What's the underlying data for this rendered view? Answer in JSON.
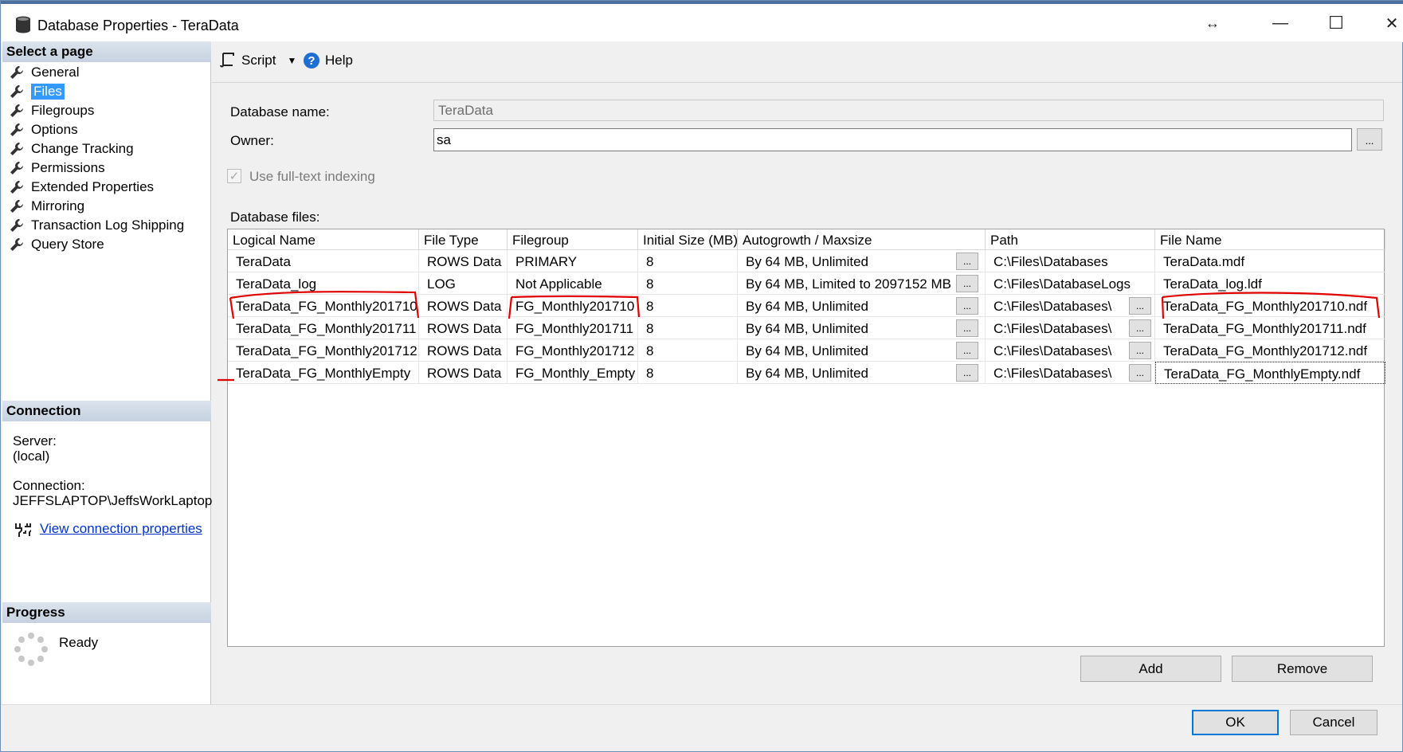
{
  "window": {
    "title": "Database Properties - TeraData",
    "controls": {
      "resize": "↔",
      "minimize": "—",
      "maximize": "☐",
      "close": "✕"
    }
  },
  "left": {
    "select_header": "Select a page",
    "pages": [
      "General",
      "Files",
      "Filegroups",
      "Options",
      "Change Tracking",
      "Permissions",
      "Extended Properties",
      "Mirroring",
      "Transaction Log Shipping",
      "Query Store"
    ],
    "selected_page": "Files",
    "connection_header": "Connection",
    "server_label": "Server:",
    "server_value": "(local)",
    "connection_label": "Connection:",
    "connection_value": "JEFFSLAPTOP\\JeffsWorkLaptop",
    "view_link": "View connection properties",
    "progress_header": "Progress",
    "progress_status": "Ready"
  },
  "toolbar": {
    "script_label": "Script",
    "help_label": "Help"
  },
  "form": {
    "dbname_label": "Database name:",
    "dbname_value": "TeraData",
    "owner_label": "Owner:",
    "owner_value": "sa",
    "fulltext_label": "Use full-text indexing",
    "fulltext_checked": true,
    "dbfiles_label": "Database files:"
  },
  "grid": {
    "columns": [
      "Logical Name",
      "File Type",
      "Filegroup",
      "Initial Size (MB)",
      "Autogrowth / Maxsize",
      "Path",
      "File Name"
    ],
    "rows": [
      [
        "TeraData",
        "ROWS Data",
        "PRIMARY",
        "8",
        "By 64 MB, Unlimited",
        "C:\\Files\\Databases",
        "TeraData.mdf"
      ],
      [
        "TeraData_log",
        "LOG",
        "Not Applicable",
        "8",
        "By 64 MB, Limited to 2097152 MB",
        "C:\\Files\\DatabaseLogs",
        "TeraData_log.ldf"
      ],
      [
        "TeraData_FG_Monthly201710",
        "ROWS Data",
        "FG_Monthly201710",
        "8",
        "By 64 MB, Unlimited",
        "C:\\Files\\Databases\\",
        "TeraData_FG_Monthly201710.ndf"
      ],
      [
        "TeraData_FG_Monthly201711",
        "ROWS Data",
        "FG_Monthly201711",
        "8",
        "By 64 MB, Unlimited",
        "C:\\Files\\Databases\\",
        "TeraData_FG_Monthly201711.ndf"
      ],
      [
        "TeraData_FG_Monthly201712",
        "ROWS Data",
        "FG_Monthly201712",
        "8",
        "By 64 MB, Unlimited",
        "C:\\Files\\Databases\\",
        "TeraData_FG_Monthly201712.ndf"
      ],
      [
        "TeraData_FG_MonthlyEmpty",
        "ROWS Data",
        "FG_Monthly_Empty",
        "8",
        "By 64 MB, Unlimited",
        "C:\\Files\\Databases\\",
        "TeraData_FG_MonthlyEmpty.ndf"
      ]
    ],
    "ellipsis": "..."
  },
  "buttons": {
    "add": "Add",
    "remove": "Remove",
    "ok": "OK",
    "cancel": "Cancel"
  },
  "colors": {
    "annotation": "#e00000",
    "selection": "#3399ff",
    "header_gradient": "#c6d2e0"
  }
}
